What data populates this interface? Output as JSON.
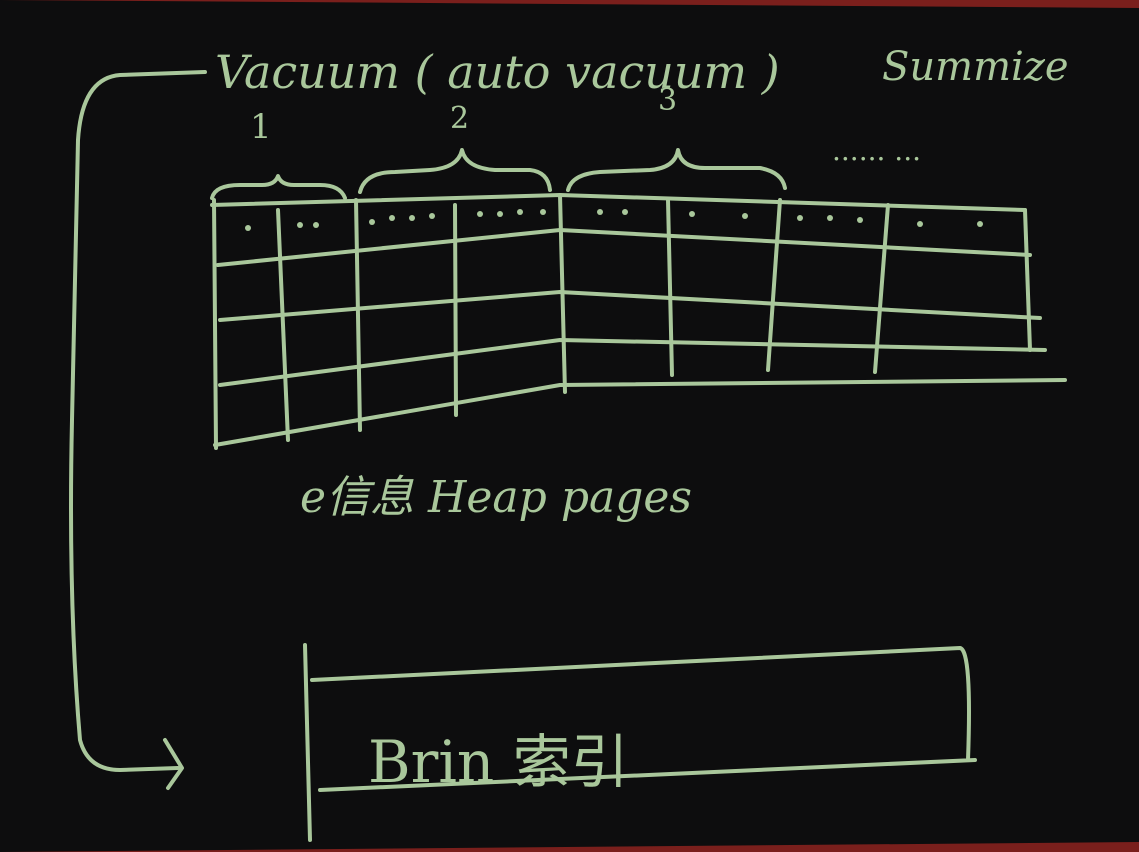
{
  "board": {
    "heading_left": "Vacuum ( auto vacuum )",
    "heading_right": "Summize",
    "range_numbers": [
      "1",
      "2",
      "3"
    ],
    "ellipsis_top": "...... ...",
    "table_caption": "e信息 Heap pages",
    "index_label": "Brin 索引"
  },
  "colors": {
    "chalk": "#a9c79b",
    "board": "#0d0d0e",
    "frame": "#7a1f1c"
  }
}
